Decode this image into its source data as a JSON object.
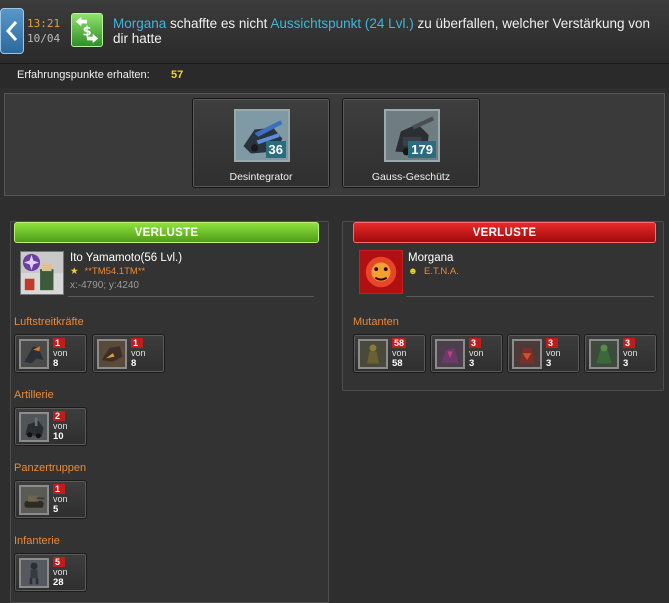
{
  "header": {
    "time": "13:21",
    "date": "10/04",
    "message": {
      "attacker": "Morgana",
      "text1": " schaffte es nicht ",
      "target": "Aussichtspunkt (24 Lvl.)",
      "text2": " zu überfallen, welcher Verstärkung von dir hatte"
    }
  },
  "experience": {
    "label": "Erfahrungspunkte erhalten:",
    "value": "57"
  },
  "rewards": [
    {
      "name": "Desintegrator",
      "count": "36"
    },
    {
      "name": "Gauss-Geschütz",
      "count": "179"
    }
  ],
  "left": {
    "header": "VERLUSTE",
    "player": {
      "name": "Ito Yamamoto(56 Lvl.)",
      "rank": "**TM54.1TM**",
      "coords": "x:-4790; y:4240"
    },
    "categories": [
      {
        "label": "Luftstreitkräfte",
        "units": [
          {
            "lost": "1",
            "of": "von",
            "total": "8"
          },
          {
            "lost": "1",
            "of": "von",
            "total": "8"
          }
        ]
      },
      {
        "label": "Artillerie",
        "units": [
          {
            "lost": "2",
            "of": "von",
            "total": "10"
          }
        ]
      },
      {
        "label": "Panzertruppen",
        "units": [
          {
            "lost": "1",
            "of": "von",
            "total": "5"
          }
        ]
      },
      {
        "label": "Infanterie",
        "units": [
          {
            "lost": "5",
            "of": "von",
            "total": "28"
          }
        ]
      }
    ]
  },
  "right": {
    "header": "VERLUSTE",
    "player": {
      "name": "Morgana",
      "rank": "E.T.N.A."
    },
    "categories": [
      {
        "label": "Mutanten",
        "units": [
          {
            "lost": "58",
            "of": "von",
            "total": "58"
          },
          {
            "lost": "3",
            "of": "von",
            "total": "3"
          },
          {
            "lost": "3",
            "of": "von",
            "total": "3"
          },
          {
            "lost": "3",
            "of": "von",
            "total": "3"
          }
        ]
      }
    ]
  },
  "colors": {
    "highlight": "#3fb6d8",
    "experience": "#f2d230",
    "category": "#e88a3a",
    "loss_green": "#6cc22a",
    "loss_red": "#d01818"
  }
}
